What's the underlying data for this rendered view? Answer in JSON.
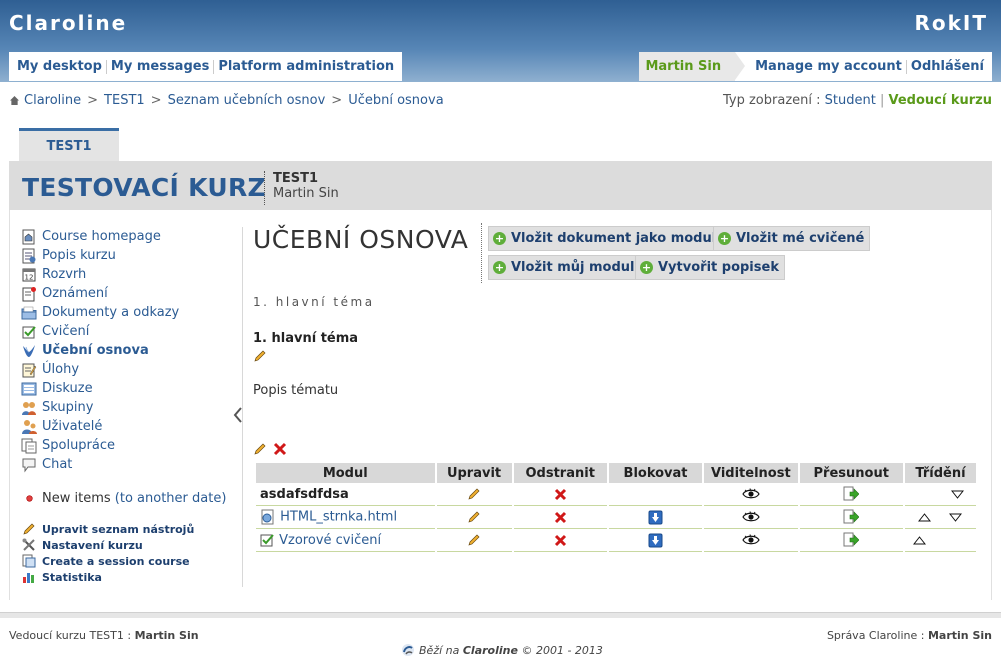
{
  "header": {
    "platform_name": "Claroline",
    "institution_name": "RokIT"
  },
  "user_nav": [
    {
      "label": "My desktop"
    },
    {
      "label": "My messages"
    },
    {
      "label": "Platform administration"
    }
  ],
  "account": {
    "user_name": "Martin Sin",
    "manage_label": "Manage my account",
    "logout_label": "Odhlášení"
  },
  "breadcrumb": [
    {
      "label": "Claroline"
    },
    {
      "label": "TEST1"
    },
    {
      "label": "Seznam učebních osnov"
    },
    {
      "label": "Učební osnova"
    }
  ],
  "view_mode": {
    "label": "Typ zobrazení :",
    "student": "Student",
    "manager": "Vedoucí kurzu"
  },
  "course_tab": {
    "label": "TEST1"
  },
  "course": {
    "title": "TESTOVACÍ KURZ",
    "code": "TEST1",
    "tutor": "Martin Sin"
  },
  "tools": [
    {
      "label": "Course homepage",
      "icon": "home-doc-icon"
    },
    {
      "label": "Popis kurzu",
      "icon": "info-doc-icon"
    },
    {
      "label": "Rozvrh",
      "icon": "calendar-icon"
    },
    {
      "label": "Oznámení",
      "icon": "announcement-icon"
    },
    {
      "label": "Dokumenty a odkazy",
      "icon": "folder-icon"
    },
    {
      "label": "Cvičení",
      "icon": "checkbox-icon"
    },
    {
      "label": "Učební osnova",
      "icon": "learning-path-icon",
      "active": true
    },
    {
      "label": "Úlohy",
      "icon": "assignment-icon"
    },
    {
      "label": "Diskuze",
      "icon": "forum-icon"
    },
    {
      "label": "Skupiny",
      "icon": "groups-icon"
    },
    {
      "label": "Uživatelé",
      "icon": "users-icon"
    },
    {
      "label": "Spolupráce",
      "icon": "wiki-icon"
    },
    {
      "label": "Chat",
      "icon": "chat-icon"
    }
  ],
  "new_items": {
    "label": "New items",
    "link": "(to another date)"
  },
  "admin_links": [
    {
      "label": "Upravit seznam nástrojů",
      "icon": "pencil-icon"
    },
    {
      "label": "Nastavení kurzu",
      "icon": "tools-icon"
    },
    {
      "label": "Create a session course",
      "icon": "session-icon"
    },
    {
      "label": "Statistika",
      "icon": "stats-icon"
    }
  ],
  "content": {
    "title": "UČEBNÍ OSNOVA",
    "commands": [
      {
        "label": "Vložit dokument jako modul"
      },
      {
        "label": "Vložit mé cvičené"
      },
      {
        "label": "Vložit můj modul"
      },
      {
        "label": "Vytvořit popisek"
      }
    ],
    "topic_path": "1. hlavní téma",
    "topic_title": "1. hlavní téma",
    "topic_desc": "Popis tématu"
  },
  "table": {
    "headers": [
      "Modul",
      "Upravit",
      "Odstranit",
      "Blokovat",
      "Viditelnost",
      "Přesunout",
      "Třídění"
    ],
    "rows": [
      {
        "name": "asdafsdfdsa",
        "type": "label",
        "block": false,
        "up": false,
        "down": true
      },
      {
        "name": "HTML_strnka.html",
        "type": "document",
        "block": true,
        "up": true,
        "down": true
      },
      {
        "name": "Vzorové cvičení",
        "type": "exercise",
        "block": true,
        "up": true,
        "down": false
      }
    ]
  },
  "footer": {
    "left_label": "Vedoucí kurzu TEST1 :",
    "left_name": "Martin Sin",
    "right_label": "Správa Claroline :",
    "right_name": "Martin Sin",
    "powered_prefix": "Běží na",
    "powered_name": "Claroline",
    "powered_suffix": "© 2001 - 2013"
  }
}
